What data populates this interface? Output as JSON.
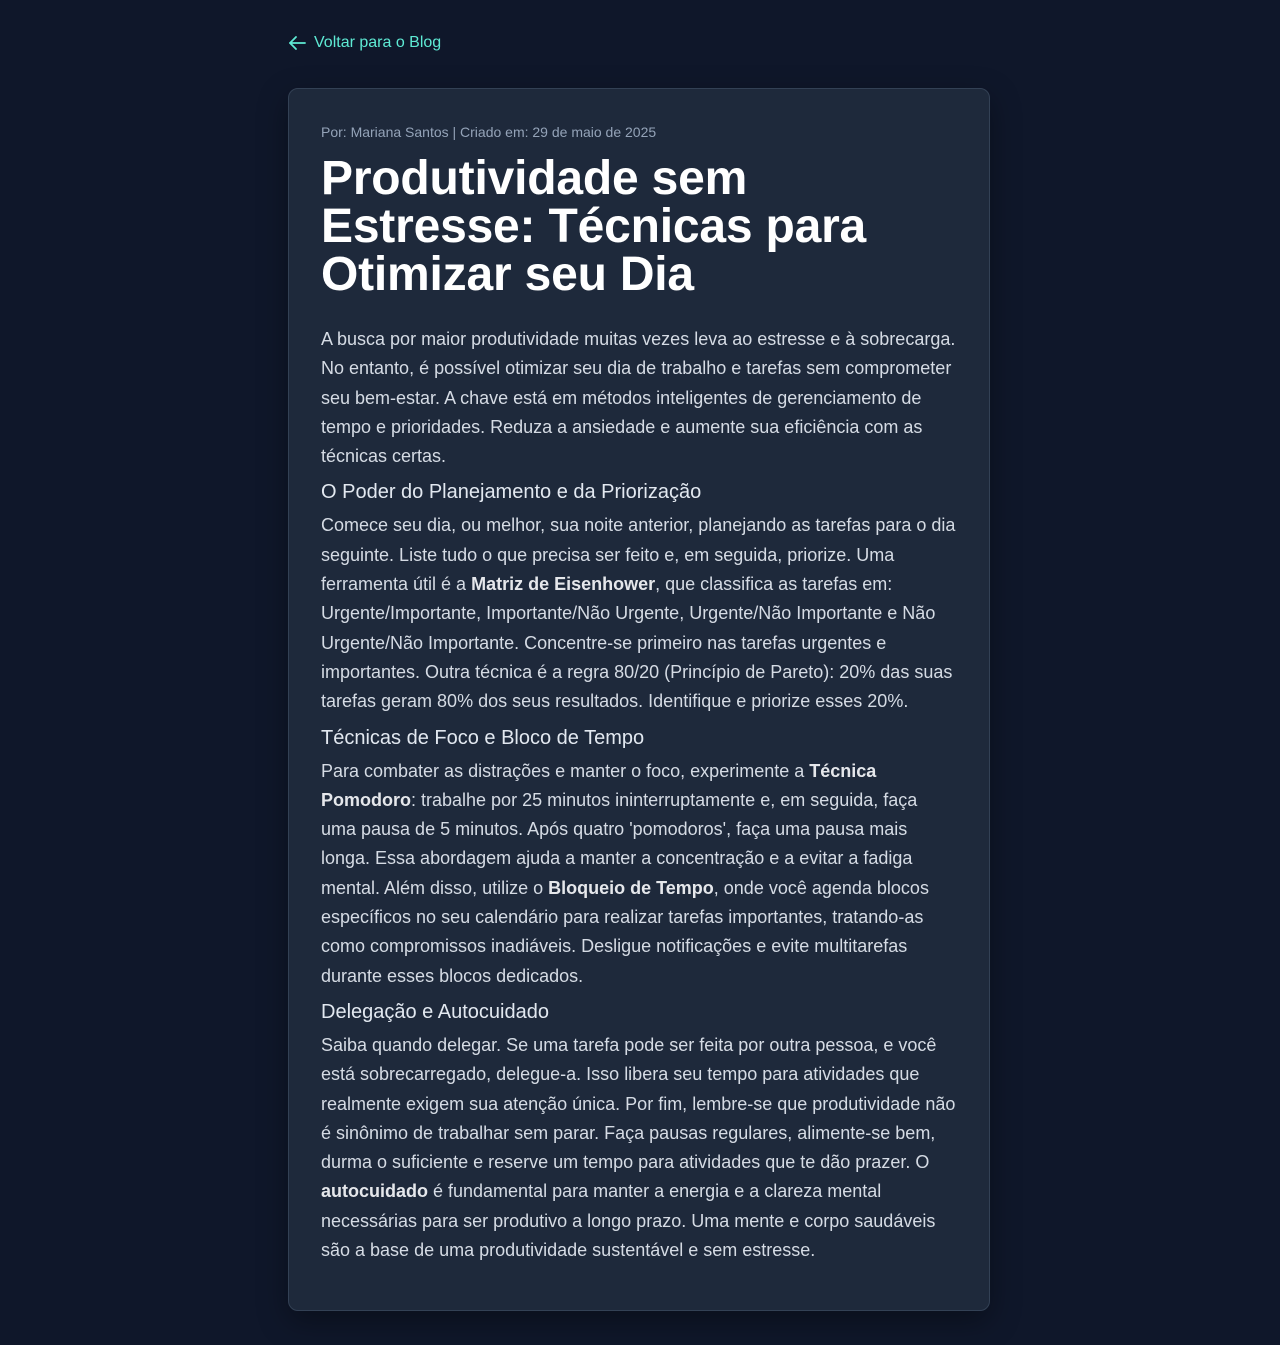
{
  "nav": {
    "back_label": "Voltar para o Blog"
  },
  "post": {
    "meta": "Por: Mariana Santos | Criado em: 29 de maio de 2025",
    "title": "Produtividade sem Estresse: Técnicas para Otimizar seu Dia",
    "intro": "A busca por maior produtividade muitas vezes leva ao estresse e à sobrecarga. No entanto, é possível otimizar seu dia de trabalho e tarefas sem comprometer seu bem-estar. A chave está em métodos inteligentes de gerenciamento de tempo e prioridades. Reduza a ansiedade e aumente sua eficiência com as técnicas certas.",
    "sections": [
      {
        "heading": "O Poder do Planejamento e da Priorização",
        "p1": "Comece seu dia, ou melhor, sua noite anterior, planejando as tarefas para o dia seguinte. Liste tudo o que precisa ser feito e, em seguida, priorize. Uma ferramenta útil é a ",
        "b1": "Matriz de Eisenhower",
        "p2": ", que classifica as tarefas em: Urgente/Importante, Importante/Não Urgente, Urgente/Não Importante e Não Urgente/Não Importante. Concentre-se primeiro nas tarefas urgentes e importantes. Outra técnica é a regra 80/20 (Princípio de Pareto): 20% das suas tarefas geram 80% dos seus resultados. Identifique e priorize esses 20%."
      },
      {
        "heading": "Técnicas de Foco e Bloco de Tempo",
        "p1": "Para combater as distrações e manter o foco, experimente a ",
        "b1": "Técnica Pomodoro",
        "p2": ": trabalhe por 25 minutos ininterruptamente e, em seguida, faça uma pausa de 5 minutos. Após quatro 'pomodoros', faça uma pausa mais longa. Essa abordagem ajuda a manter a concentração e a evitar a fadiga mental. Além disso, utilize o ",
        "b2": "Bloqueio de Tempo",
        "p3": ", onde você agenda blocos específicos no seu calendário para realizar tarefas importantes, tratando-as como compromissos inadiáveis. Desligue notificações e evite multitarefas durante esses blocos dedicados."
      },
      {
        "heading": "Delegação e Autocuidado",
        "p1": "Saiba quando delegar. Se uma tarefa pode ser feita por outra pessoa, e você está sobrecarregado, delegue-a. Isso libera seu tempo para atividades que realmente exigem sua atenção única. Por fim, lembre-se que produtividade não é sinônimo de trabalhar sem parar. Faça pausas regulares, alimente-se bem, durma o suficiente e reserve um tempo para atividades que te dão prazer. O ",
        "b1": "autocuidado",
        "p2": " é fundamental para manter a energia e a clareza mental necessárias para ser produtivo a longo prazo. Uma mente e corpo saudáveis são a base de uma produtividade sustentável e sem estresse."
      }
    ]
  },
  "colors": {
    "background": "#0f172a",
    "card": "#1e293b",
    "accent": "#5eead4"
  }
}
